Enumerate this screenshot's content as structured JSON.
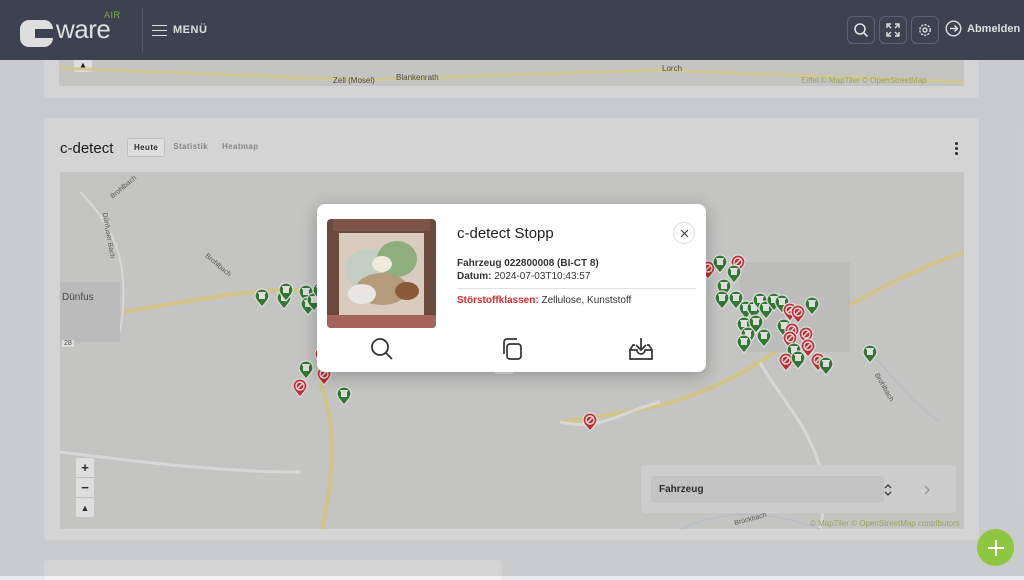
{
  "header": {
    "logo_text": "ware",
    "logo_air": "AIR",
    "menu_label": "MENÜ",
    "logout_label": "Abmelden"
  },
  "top_map": {
    "places": [
      "Zell (Mosel)",
      "Blankenrath",
      "Lorch"
    ],
    "attribution": "Eiffel © MapTiler © OpenStreetMap contributors"
  },
  "section": {
    "title": "c-detect",
    "tabs": [
      {
        "label": "Heute",
        "active": true
      },
      {
        "label": "Statistik",
        "active": false
      },
      {
        "label": "Heatmap",
        "active": false
      }
    ]
  },
  "map": {
    "places": [
      "Dünfus",
      "Brohlbach",
      "Dünfuser Bach",
      "Brohlbach",
      "Brohlbach",
      "Brückbach"
    ],
    "road_labels": [
      "28",
      "B 28"
    ],
    "attribution": "© MapTiler © OpenStreetMap contributors",
    "zoom_in": "+",
    "zoom_out": "−",
    "reset_north": "▲",
    "filter_label": "Fahrzeug"
  },
  "popup": {
    "title": "c-detect Stopp",
    "vehicle": "Fahrzeug 022800008 (BI-CT 8)",
    "date_label": "Datum:",
    "date_value": "2024-07-03T10:43:57",
    "classes_label": "Störstoffklassen:",
    "classes_value": "Zellulose, Kunststoff",
    "actions": [
      "search-icon",
      "copy-icon",
      "download-icon"
    ]
  },
  "colors": {
    "topbar": "#454c5c",
    "accent_green": "#8ec641",
    "pin_green": "#3a8a3c",
    "pin_red": "#d9363e",
    "alert_red": "#d42b2b"
  }
}
